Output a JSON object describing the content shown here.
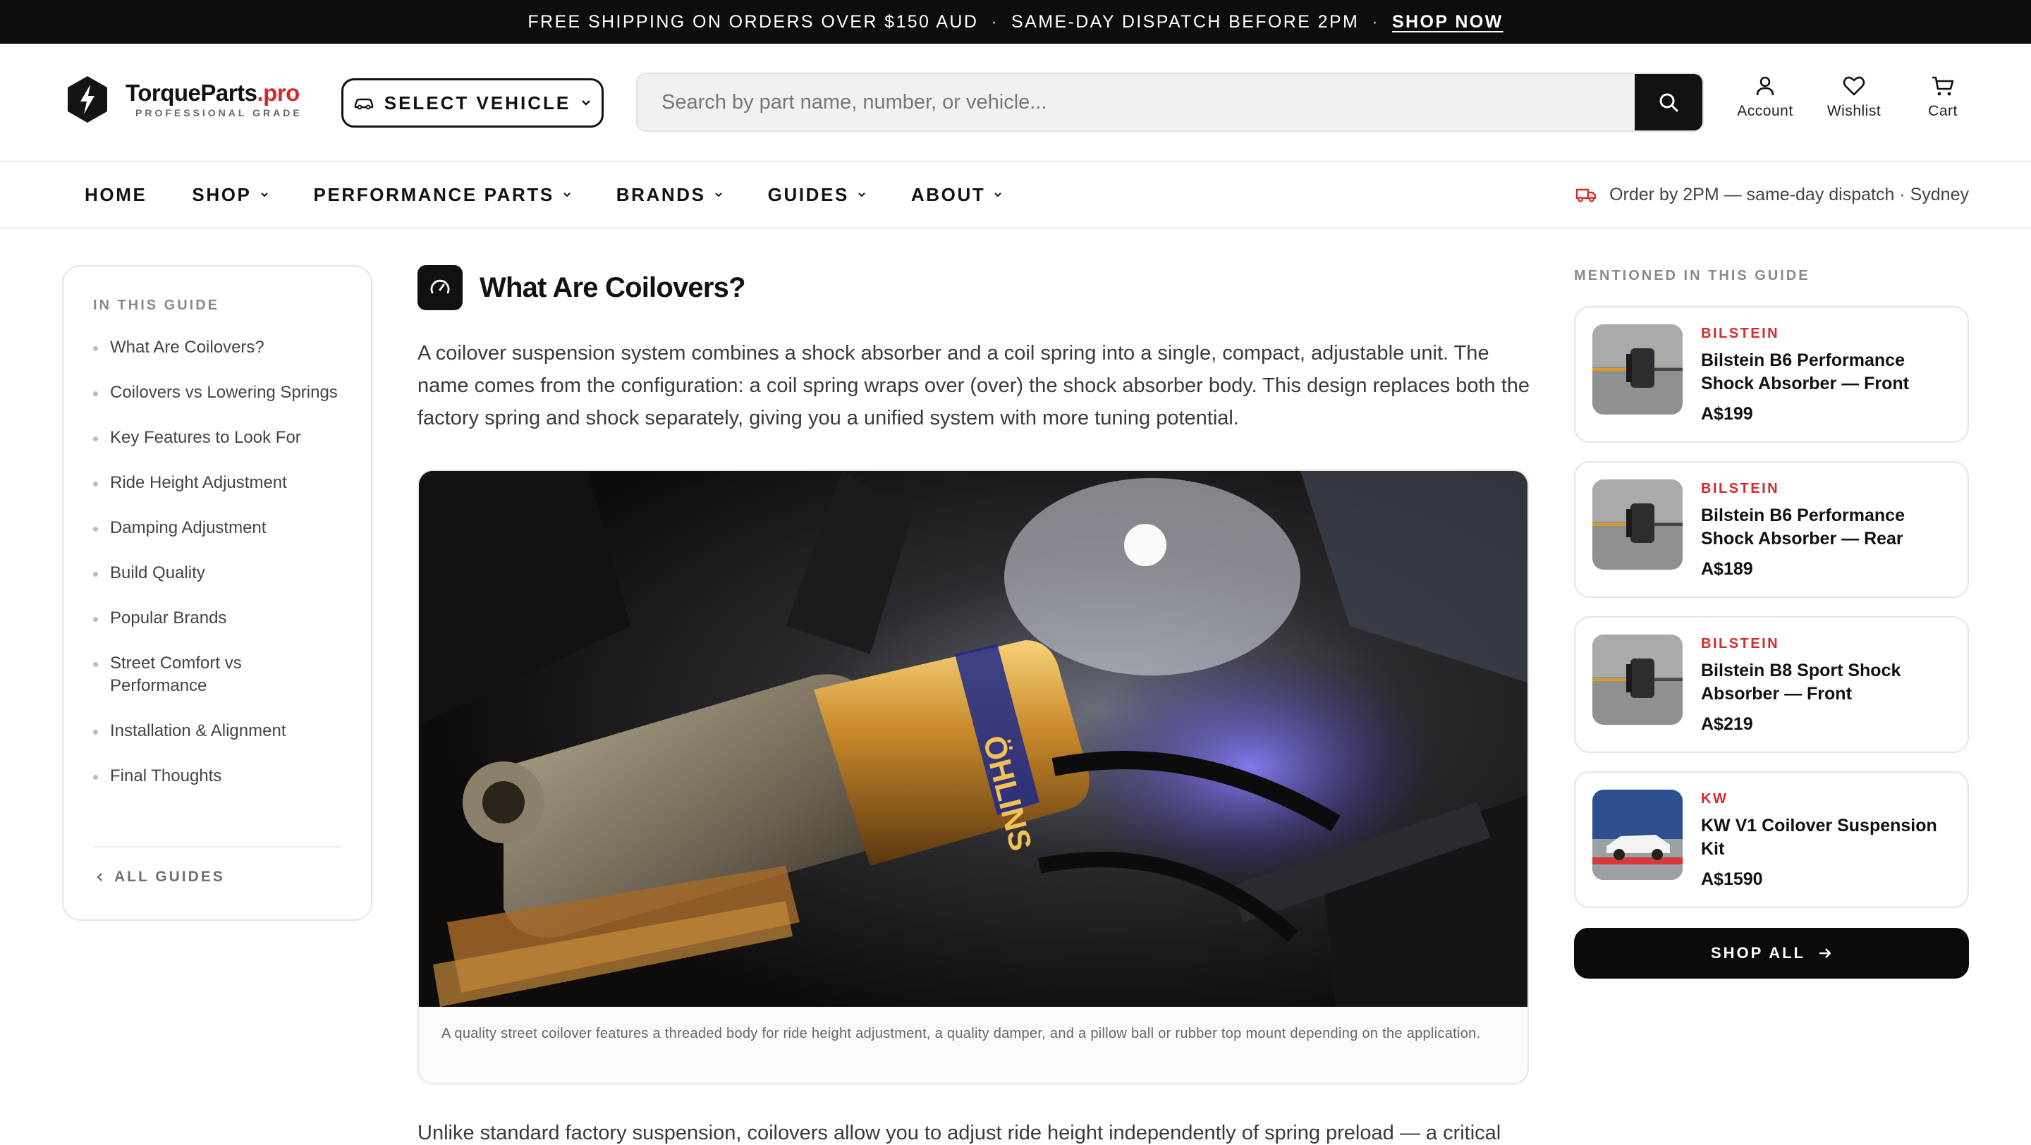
{
  "announcement": {
    "shipping": "FREE SHIPPING ON ORDERS OVER $150 AUD",
    "dispatch": "SAME-DAY DISPATCH BEFORE 2PM",
    "separator": "·",
    "cta": "SHOP NOW"
  },
  "header": {
    "logo_name": "TorqueParts",
    "logo_tld": ".pro",
    "logo_tagline": "PROFESSIONAL GRADE",
    "vehicle_button": "SELECT VEHICLE",
    "search_placeholder": "Search by part name, number, or vehicle...",
    "actions": {
      "account": "Account",
      "wishlist": "Wishlist",
      "cart": "Cart"
    }
  },
  "nav": {
    "items": [
      {
        "label": "HOME",
        "has_dropdown": false
      },
      {
        "label": "SHOP",
        "has_dropdown": true
      },
      {
        "label": "PERFORMANCE PARTS",
        "has_dropdown": true
      },
      {
        "label": "BRANDS",
        "has_dropdown": true
      },
      {
        "label": "GUIDES",
        "has_dropdown": true
      },
      {
        "label": "ABOUT",
        "has_dropdown": true
      }
    ],
    "dispatch_note": "Order by 2PM — same-day dispatch · Sydney"
  },
  "toc": {
    "title": "IN THIS GUIDE",
    "items": [
      "What Are Coilovers?",
      "Coilovers vs Lowering Springs",
      "Key Features to Look For",
      "Ride Height Adjustment",
      "Damping Adjustment",
      "Build Quality",
      "Popular Brands",
      "Street Comfort vs Performance",
      "Installation & Alignment",
      "Final Thoughts"
    ],
    "back_link": "ALL GUIDES"
  },
  "article": {
    "heading": "What Are Coilovers?",
    "intro": "A coilover suspension system combines a shock absorber and a coil spring into a single, compact, adjustable unit. The name comes from the configuration: a coil spring wraps over (over) the shock absorber body. This design replaces both the factory spring and shock separately, giving you a unified system with more tuning potential.",
    "figure_caption": "A quality street coilover features a threaded body for ride height adjustment, a quality damper, and a pillow ball or rubber top mount depending on the application.",
    "photo_label": "ÖHLINS",
    "next_paragraph": "Unlike standard factory suspension, coilovers allow you to adjust ride height independently of spring preload — a critical"
  },
  "mentioned": {
    "title": "MENTIONED IN THIS GUIDE",
    "products": [
      {
        "brand": "BILSTEIN",
        "name": "Bilstein B6 Performance Shock Absorber — Front",
        "price": "A$199"
      },
      {
        "brand": "BILSTEIN",
        "name": "Bilstein B6 Performance Shock Absorber — Rear",
        "price": "A$189"
      },
      {
        "brand": "BILSTEIN",
        "name": "Bilstein B8 Sport Shock Absorber — Front",
        "price": "A$219"
      },
      {
        "brand": "KW",
        "name": "KW V1 Coilover Suspension Kit",
        "price": "A$1590"
      }
    ],
    "shop_all": "SHOP ALL"
  },
  "colors": {
    "accent": "#d42a2a",
    "dark": "#0d0d0d",
    "border": "#e4e4e4"
  }
}
